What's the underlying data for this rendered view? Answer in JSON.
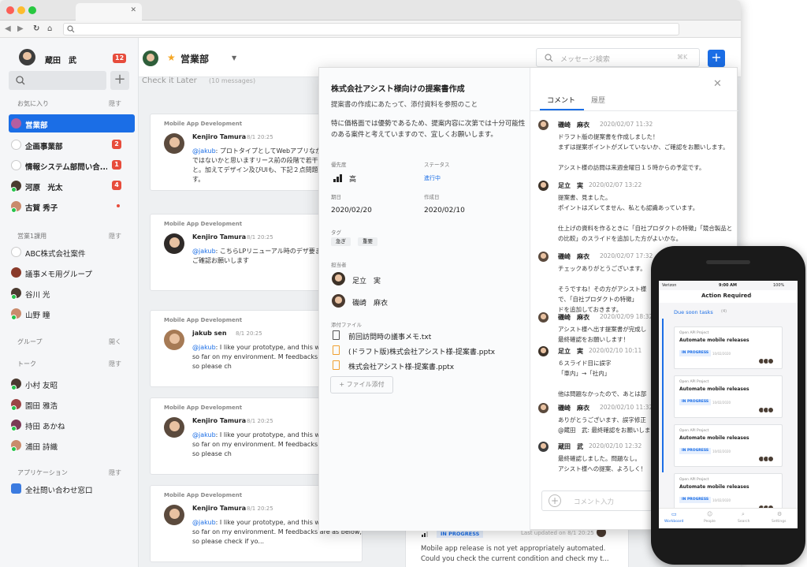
{
  "sidebar": {
    "user_name": "蔵田　武",
    "user_badge": "12",
    "fav_label": "お気に入り",
    "fav_toggle": "隠す",
    "fav_items": [
      {
        "label": "営業部",
        "badge": ""
      },
      {
        "label": "企画事業部",
        "badge": "2"
      },
      {
        "label": "情報システム部問い合...",
        "badge": "1"
      },
      {
        "label": "河原　光太",
        "badge": "4"
      },
      {
        "label": "古賀 秀子",
        "badge": ""
      }
    ],
    "dept_label": "営業1課用",
    "dept_toggle": "隠す",
    "dept_items": [
      "ABC株式会社案件",
      "議事メモ用グループ",
      "谷川 光",
      "山野 瞳"
    ],
    "group_label": "グループ",
    "group_toggle": "開く",
    "talk_label": "トーク",
    "talk_toggle": "隠す",
    "talk_items": [
      "小村 友昭",
      "園田 雅浩",
      "持田 あかね",
      "浦田 詩織"
    ],
    "app_label": "アプリケーション",
    "app_toggle": "隠す",
    "app_items": [
      "全社問い合わせ窓口"
    ]
  },
  "header": {
    "channel": "営業部",
    "subtitle": "Check it Later",
    "count": "(10 messages)",
    "search_placeholder": "メッセージ検索",
    "search_shortcut": "⌘K",
    "add": "+"
  },
  "cards": [
    {
      "project": "Mobile App Development",
      "name": "Kenjiro Tamura",
      "time": "8/1 20:25",
      "mention": "@jakub",
      "text": ": プロトタイプとしてWebアプリなか出来が良いのではないかと思いますリース前の段階で若干の修正を加えれと。加えてデザイン及びUIも、下記２点問題ないかと考えます。"
    },
    {
      "project": "Mobile App Development",
      "name": "Kenjiro Tamura",
      "time": "8/1 20:25",
      "mention": "@jakub",
      "text": ": こちらLPリニューアル時のデザ要まとめているのでご確認お願いします"
    },
    {
      "project": "Mobile App Development",
      "name": "jakub sen",
      "time": "8/1 20:25",
      "mention": "@jakub",
      "text": ": I like your prototype, and this w pretty great so far on my environment. M feedbacks are as below, so please ch"
    },
    {
      "project": "Mobile App Development",
      "name": "Kenjiro Tamura",
      "time": "8/1 20:25",
      "mention": "@jakub",
      "text": ": I like your prototype, and this w pretty great so far on my environment. M feedbacks are as below, so please ch"
    },
    {
      "project": "Mobile App Development",
      "name": "Kenjiro Tamura",
      "time": "8/1 20:25",
      "mention": "@jakub",
      "text": ": I like your prototype, and this w pretty great so far on my environment. M feedbacks are as below, so please check if yo..."
    }
  ],
  "task": {
    "title": "株式会社アシスト様向けの提案書作成",
    "summary": "提案書の作成にあたって、添付資料を参照のこと",
    "description": "特に価格面では優勢であるため、提案内容に次第では十分可能性のある案件と考えていますので、宜しくお願いします。",
    "priority_label": "優先度",
    "priority": "高",
    "status_label": "ステータス",
    "status": "進行中",
    "due_label": "期日",
    "due": "2020/02/20",
    "created_label": "作成日",
    "created": "2020/02/10",
    "tags_label": "タグ",
    "tags": [
      "急ぎ",
      "重要"
    ],
    "assignee_label": "担当者",
    "assignees": [
      "足立　実",
      "磯崎　麻衣"
    ],
    "files_label": "添付ファイル",
    "files": [
      "前回訪問時の議事メモ.txt",
      "(ドラフト版)株式会社アシスト様-提案書.pptx",
      "株式会社アシスト様-提案書.pptx"
    ],
    "add_file": "+ ファイル添付",
    "tab_comments": "コメント",
    "tab_history": "履歴",
    "comment_placeholder": "コメント入力"
  },
  "comments": [
    {
      "name": "磯崎　麻衣",
      "time": "2020/02/07 11:32",
      "text": "ドラフト版の提案書を作成しました！\nまずは提案ポイントがズレていないか、ご確認をお願いします。\n\nアシスト様の訪問は来週金曜日１５時からの予定です。"
    },
    {
      "name": "足立　実",
      "time": "2020/02/07 13:22",
      "text": "提案書、見ました。\nポイントはズレてません、私とも認識あっています。\n\n仕上げの資料を作るときに「自社プロダクトの特徴」「競合製品との比較」のスライドを追加した方がよいかな。"
    },
    {
      "name": "磯崎　麻衣",
      "time": "2020/02/07 17:32",
      "text": "チェックありがとうございます。\n\nそうですね！その方がアシスト様\nで、「自社プロダクトの特徴」\nドを追加しておきます。"
    },
    {
      "name": "磯崎　麻衣",
      "time": "2020/02/09 18:32",
      "text": "アシスト様へ出す提案書が完成し\n最終確認をお願いします！"
    },
    {
      "name": "足立　実",
      "time": "2020/02/10 10:11",
      "text": "６スライド目に誤字\n「車内」→「社内」\n\n他は問題なかったので、あとは部"
    },
    {
      "name": "磯崎　麻衣",
      "time": "2020/02/10 11:32",
      "text": "ありがとうございます、誤字修正\n@蔵田　武: 最終確認をお願いしま"
    },
    {
      "name": "蔵田　武",
      "time": "2020/02/10 12:32",
      "text": "最終確認しました。問題なし。\nアシスト様への提案、よろしく！"
    }
  ],
  "bottom_card": {
    "status": "IN PROGRESS",
    "updated": "Last updated on 8/1 20:25",
    "text": "Mobile app release is not yet appropriately automated. Could you check the current condition and check my t..."
  },
  "phone": {
    "carrier": "Verizon",
    "clock": "9:00 AM",
    "battery": "100%",
    "title": "Action Required",
    "section": "Due soon tasks",
    "section_count": "(4)",
    "tasks": [
      {
        "project": "Open API Project",
        "title": "Automate mobile releases",
        "status": "IN PROGRESS",
        "date": "10/02/2020"
      },
      {
        "project": "Open API Project",
        "title": "Automate mobile releases",
        "status": "IN PROGRESS",
        "date": "10/02/2020"
      },
      {
        "project": "Open API Project",
        "title": "Automate mobile releases",
        "status": "IN PROGRESS",
        "date": "10/02/2020"
      },
      {
        "project": "Open API Project",
        "title": "Automate mobile releases",
        "status": "IN PROGRESS",
        "date": "10/02/2020"
      }
    ],
    "tabs": [
      "Workboard",
      "People",
      "Search",
      "Settings"
    ]
  }
}
